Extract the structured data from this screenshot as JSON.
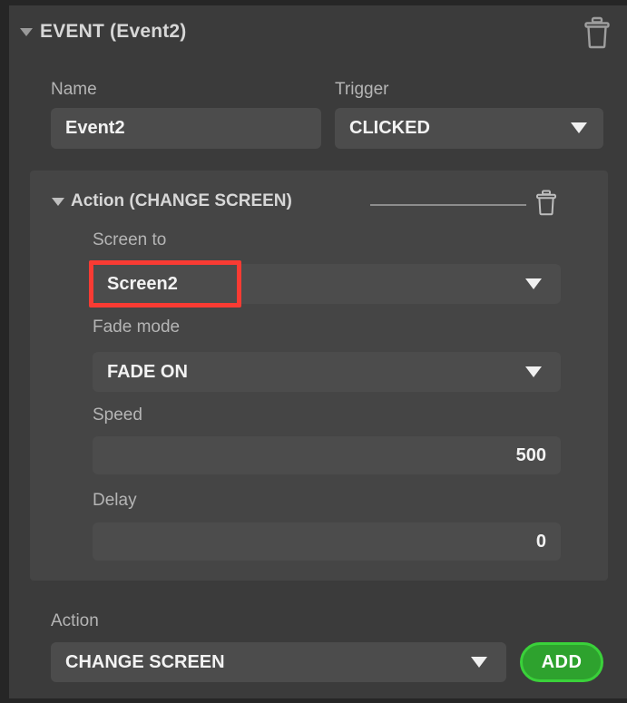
{
  "panel": {
    "title": "EVENT (Event2)",
    "collapse_icon": "triangle-down-icon",
    "delete_icon": "trash-icon"
  },
  "event": {
    "name_label": "Name",
    "name_value": "Event2",
    "trigger_label": "Trigger",
    "trigger_value": "CLICKED",
    "trigger_caret": "chevron-down-icon"
  },
  "action_group": {
    "title": "Action (CHANGE SCREEN)",
    "collapse_icon": "triangle-down-icon",
    "delete_icon": "trash-icon",
    "fields": {
      "screen_to_label": "Screen to",
      "screen_to_value": "Screen2",
      "fade_mode_label": "Fade mode",
      "fade_mode_value": "FADE ON",
      "speed_label": "Speed",
      "speed_value": "500",
      "delay_label": "Delay",
      "delay_value": "0"
    }
  },
  "footer": {
    "action_label": "Action",
    "action_value": "CHANGE SCREEN",
    "add_label": "ADD"
  },
  "colors": {
    "window_bg": "#262626",
    "panel_bg": "#3b3b3b",
    "group_bg": "#454545",
    "field_bg": "#4c4c4c",
    "label_text": "#b5b5b5",
    "value_text": "#f2f2f2",
    "highlight": "#f93b33",
    "add_fill": "#2ea22e",
    "add_border": "#3ad13a"
  }
}
